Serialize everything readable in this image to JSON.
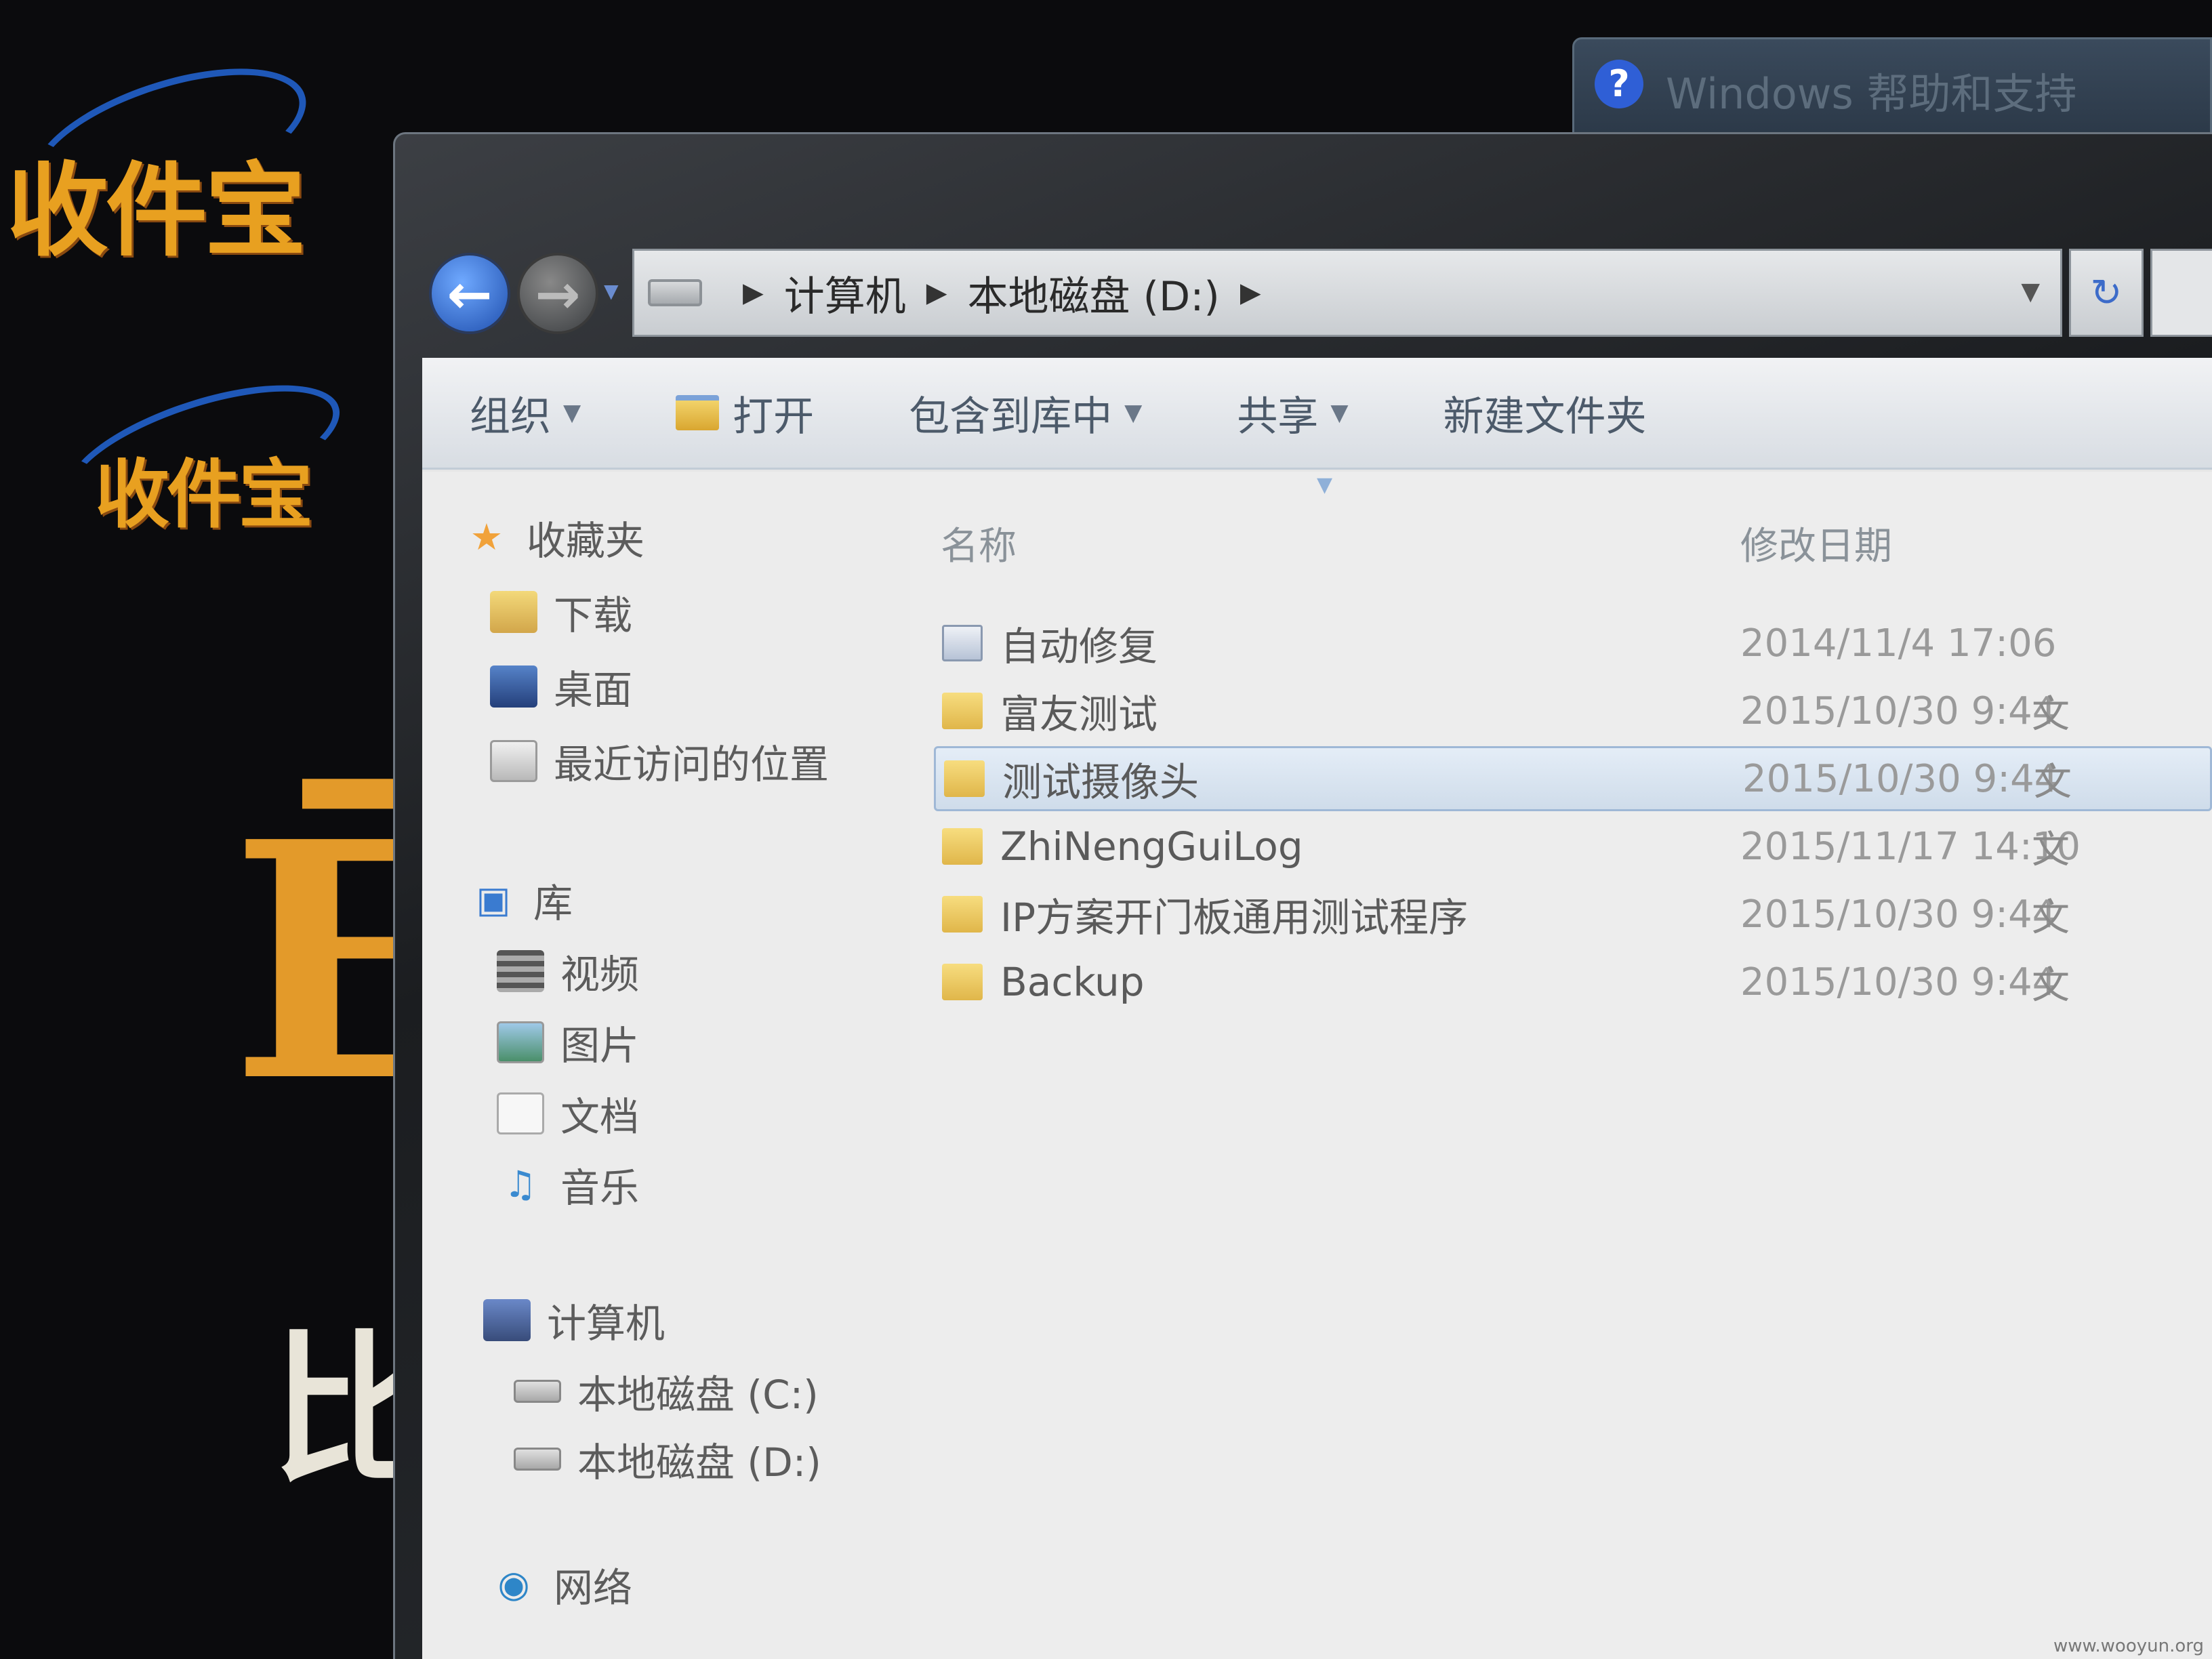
{
  "desktop": {
    "logo_text": "收件宝",
    "glyph_big": "Ē",
    "glyph_bi": "比"
  },
  "help_window": {
    "icon": "?",
    "title": "Windows 帮助和支持"
  },
  "explorer": {
    "address": {
      "crumbs": [
        "计算机",
        "本地磁盘 (D:)"
      ]
    },
    "toolbar": {
      "organize": "组织",
      "open": "打开",
      "include_in_library": "包含到库中",
      "share": "共享",
      "new_folder": "新建文件夹"
    },
    "navpane": {
      "favorites": "收藏夹",
      "downloads": "下载",
      "desktop": "桌面",
      "recent": "最近访问的位置",
      "libraries": "库",
      "videos": "视频",
      "pictures": "图片",
      "documents": "文档",
      "music": "音乐",
      "computer": "计算机",
      "drive_c": "本地磁盘 (C:)",
      "drive_d": "本地磁盘 (D:)",
      "network": "网络"
    },
    "filelist": {
      "columns": {
        "name": "名称",
        "modified": "修改日期"
      },
      "rows": [
        {
          "name": "自动修复",
          "date": "2014/11/4 17:06",
          "type": "",
          "icon": "system-folder-icon",
          "selected": false
        },
        {
          "name": "富友测试",
          "date": "2015/10/30 9:44",
          "type": "文",
          "icon": "folder-icon",
          "selected": false
        },
        {
          "name": "测试摄像头",
          "date": "2015/10/30 9:44",
          "type": "文",
          "icon": "folder-icon",
          "selected": true
        },
        {
          "name": "ZhiNengGuiLog",
          "date": "2015/11/17 14:10",
          "type": "文",
          "icon": "folder-icon",
          "selected": false
        },
        {
          "name": "IP方案开门板通用测试程序",
          "date": "2015/10/30 9:44",
          "type": "文",
          "icon": "folder-icon",
          "selected": false
        },
        {
          "name": "Backup",
          "date": "2015/10/30 9:44",
          "type": "文",
          "icon": "folder-icon",
          "selected": false
        }
      ]
    }
  },
  "watermark": "www.wooyun.org"
}
